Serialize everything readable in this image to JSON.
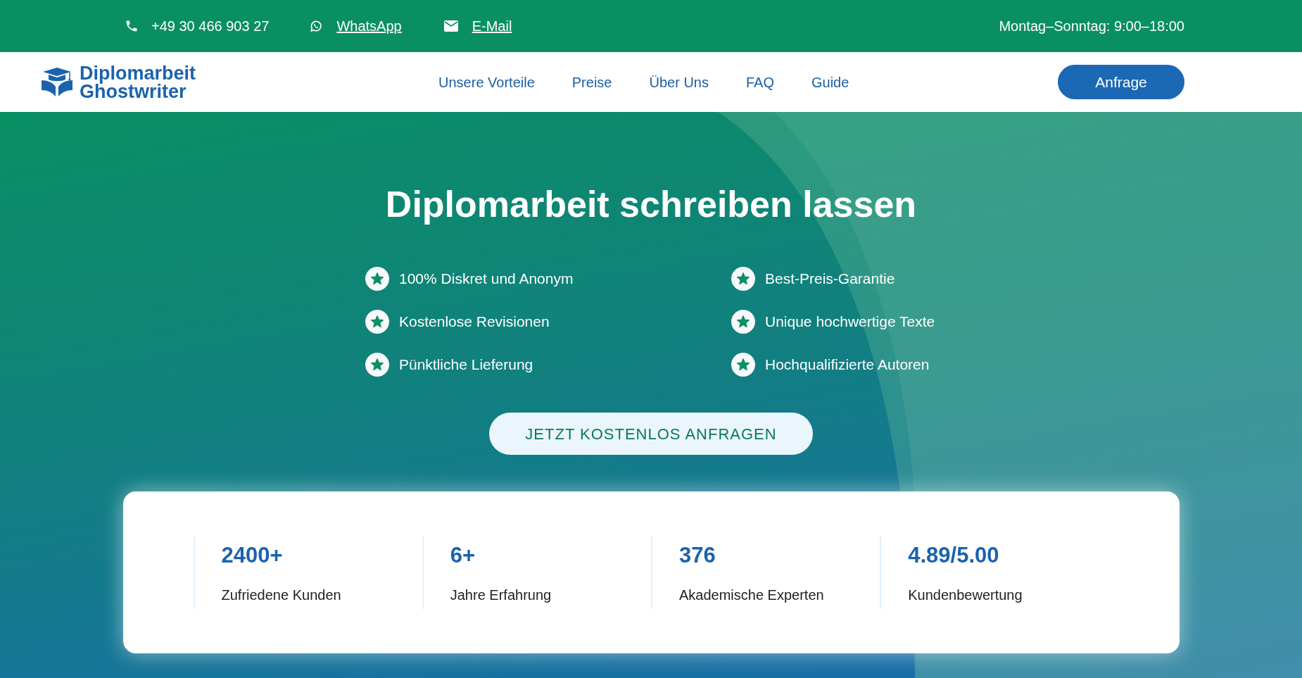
{
  "top_bar": {
    "phone": "+49 30 466 903 27",
    "whatsapp": "WhatsApp",
    "email": "E-Mail",
    "hours": "Montag–Sonntag: 9:00–18:00"
  },
  "header": {
    "logo_line_1": "Diplomarbeit",
    "logo_line_2": "Ghostwriter",
    "nav": [
      "Unsere Vorteile",
      "Preise",
      "Über Uns",
      "FAQ",
      "Guide"
    ],
    "button": "Anfrage"
  },
  "hero": {
    "title": "Diplomarbeit schreiben lassen",
    "features": [
      "100% Diskret und Anonym",
      "Best-Preis-Garantie",
      "Kostenlose Revisionen",
      "Unique hochwertige Texte",
      "Pünktliche Lieferung",
      "Hochqualifizierte Autoren"
    ],
    "cta": "JETZT KOSTENLOS ANFRAGEN"
  },
  "stats": [
    {
      "value": "2400+",
      "label": "Zufriedene Kunden"
    },
    {
      "value": "6+",
      "label": "Jahre Erfahrung"
    },
    {
      "value": "376",
      "label": "Akademische Experten"
    },
    {
      "value": "4.89/5.00",
      "label": "Kundenbewertung"
    }
  ]
}
